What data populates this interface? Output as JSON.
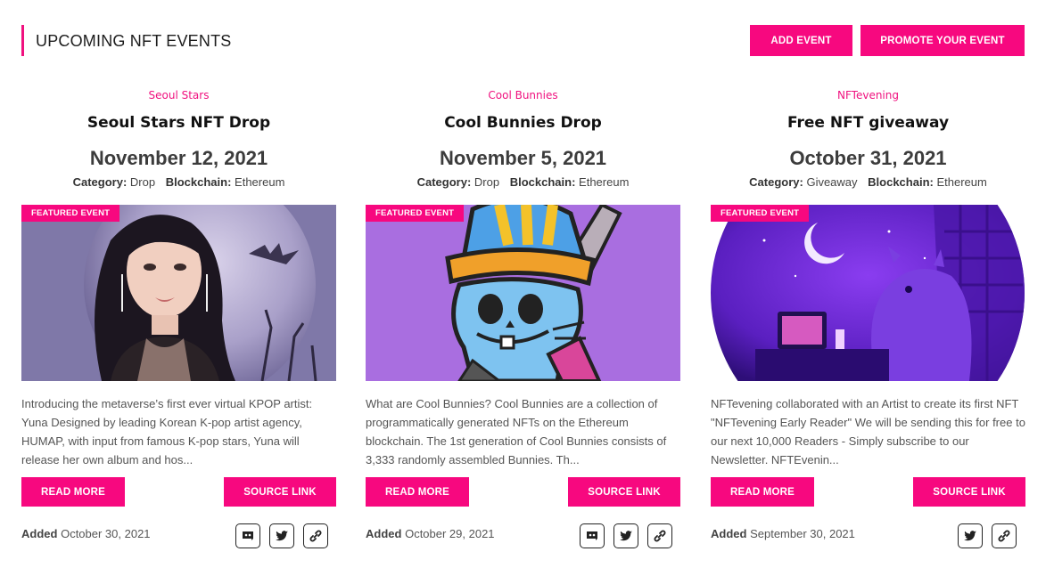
{
  "header": {
    "title": "UPCOMING NFT EVENTS",
    "add_event_label": "ADD EVENT",
    "promote_label": "PROMOTE YOUR EVENT"
  },
  "colors": {
    "accent": "#f7087f",
    "text_dark": "#1d1d1d",
    "text_muted": "#555555"
  },
  "events": [
    {
      "org": "Seoul Stars",
      "title": "Seoul Stars NFT Drop",
      "date": "November 12, 2021",
      "category_label": "Category:",
      "category": "Drop",
      "blockchain_label": "Blockchain:",
      "blockchain": "Ethereum",
      "badge": "FEATURED EVENT",
      "image_subject": "kpop-avatar-portrait",
      "description": "Introducing the metaverse’s first ever virtual KPOP artist: Yuna Designed by leading Korean K-pop artist agency, HUMAP, with input from famous K-pop stars, Yuna will release her own album and hos...",
      "read_more": "READ MORE",
      "source_link": "SOURCE LINK",
      "added_label": "Added",
      "added_date": "October 30, 2021",
      "icons": [
        "discord-icon",
        "twitter-icon",
        "link-icon"
      ]
    },
    {
      "org": "Cool Bunnies",
      "title": "Cool Bunnies Drop",
      "date": "November 5, 2021",
      "category_label": "Category:",
      "category": "Drop",
      "blockchain_label": "Blockchain:",
      "blockchain": "Ethereum",
      "badge": "FEATURED EVENT",
      "image_subject": "cartoon-bunny-viking-helmet",
      "description": "What are Cool Bunnies? Cool Bunnies are a collection of programmatically generated NFTs on the Ethereum blockchain. The 1st generation of Cool Bunnies consists of 3,333 randomly assembled Bunnies. Th...",
      "read_more": "READ MORE",
      "source_link": "SOURCE LINK",
      "added_label": "Added",
      "added_date": "October 29, 2021",
      "icons": [
        "discord-icon",
        "twitter-icon",
        "link-icon"
      ]
    },
    {
      "org": "NFTevening",
      "title": "Free NFT giveaway",
      "date": "October 31, 2021",
      "category_label": "Category:",
      "category": "Giveaway",
      "blockchain_label": "Blockchain:",
      "blockchain": "Ethereum",
      "badge": "FEATURED EVENT",
      "image_subject": "purple-night-reader-scene",
      "description": "NFTevening collaborated with an Artist to create its first NFT \"NFTevening Early Reader\" We will be sending this for free to our next 10,000 Readers - Simply subscribe to our Newsletter. NFTEvenin...",
      "read_more": "READ MORE",
      "source_link": "SOURCE LINK",
      "added_label": "Added",
      "added_date": "September 30, 2021",
      "icons": [
        "twitter-icon",
        "link-icon"
      ]
    }
  ]
}
